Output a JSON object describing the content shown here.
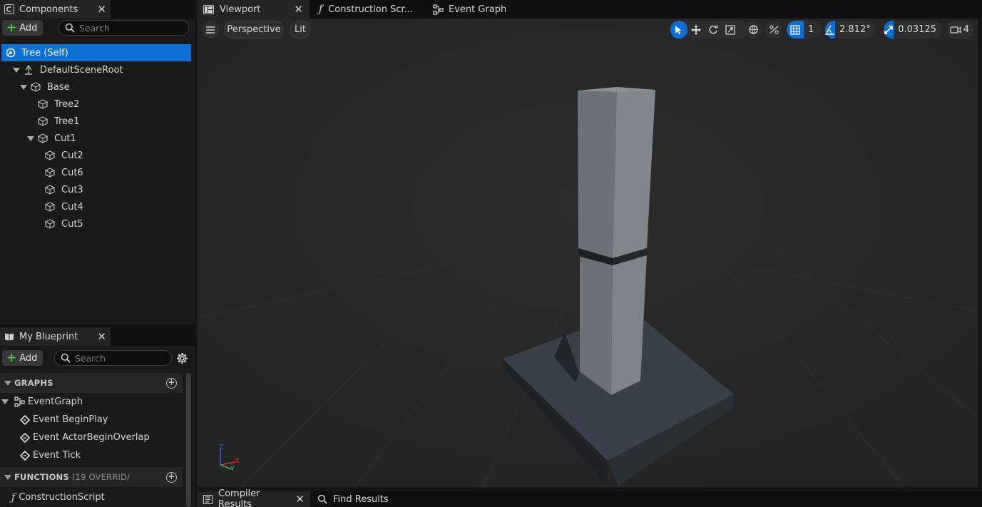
{
  "components_panel": {
    "tab_title": "Components",
    "add_label": "Add",
    "search_placeholder": "Search",
    "tree": [
      {
        "label": "Tree (Self)",
        "depth": 0,
        "selected": true
      },
      {
        "label": "DefaultSceneRoot",
        "depth": 1
      },
      {
        "label": "Base",
        "depth": 2
      },
      {
        "label": "Tree2",
        "depth": 3
      },
      {
        "label": "Tree1",
        "depth": 3
      },
      {
        "label": "Cut1",
        "depth": 3
      },
      {
        "label": "Cut2",
        "depth": 4
      },
      {
        "label": "Cut6",
        "depth": 4
      },
      {
        "label": "Cut3",
        "depth": 4
      },
      {
        "label": "Cut4",
        "depth": 4
      },
      {
        "label": "Cut5",
        "depth": 4
      }
    ]
  },
  "my_blueprint_panel": {
    "tab_title": "My Blueprint",
    "add_label": "Add",
    "search_placeholder": "Search",
    "graphs_header": "GRAPHS",
    "graphs": [
      {
        "label": "EventGraph"
      },
      {
        "label": "Event BeginPlay"
      },
      {
        "label": "Event ActorBeginOverlap"
      },
      {
        "label": "Event Tick"
      }
    ],
    "functions_header": "FUNCTIONS",
    "functions_sub": "(19 OVERRID/",
    "functions": [
      {
        "label": "ConstructionScript"
      }
    ]
  },
  "editor_tabs": [
    {
      "label": "Viewport",
      "active": true
    },
    {
      "label": "Construction Scr..."
    },
    {
      "label": "Event Graph"
    }
  ],
  "viewport_toolbar": {
    "perspective_label": "Perspective",
    "lit_label": "Lit",
    "grid_snap_value": "1",
    "rotation_snap_value": "2.812°",
    "scale_snap_value": "0.03125",
    "camera_speed_value": "4"
  },
  "axis_gizmo": {
    "x": "X",
    "y": "Y",
    "z": "Z"
  },
  "bottom_tabs": [
    {
      "label": "Compiler Results"
    },
    {
      "label": "Find Results"
    }
  ],
  "colors": {
    "selection": "#0d70d4",
    "accent_blue": "#0d6fd3",
    "add_green": "#4fbf4f"
  }
}
